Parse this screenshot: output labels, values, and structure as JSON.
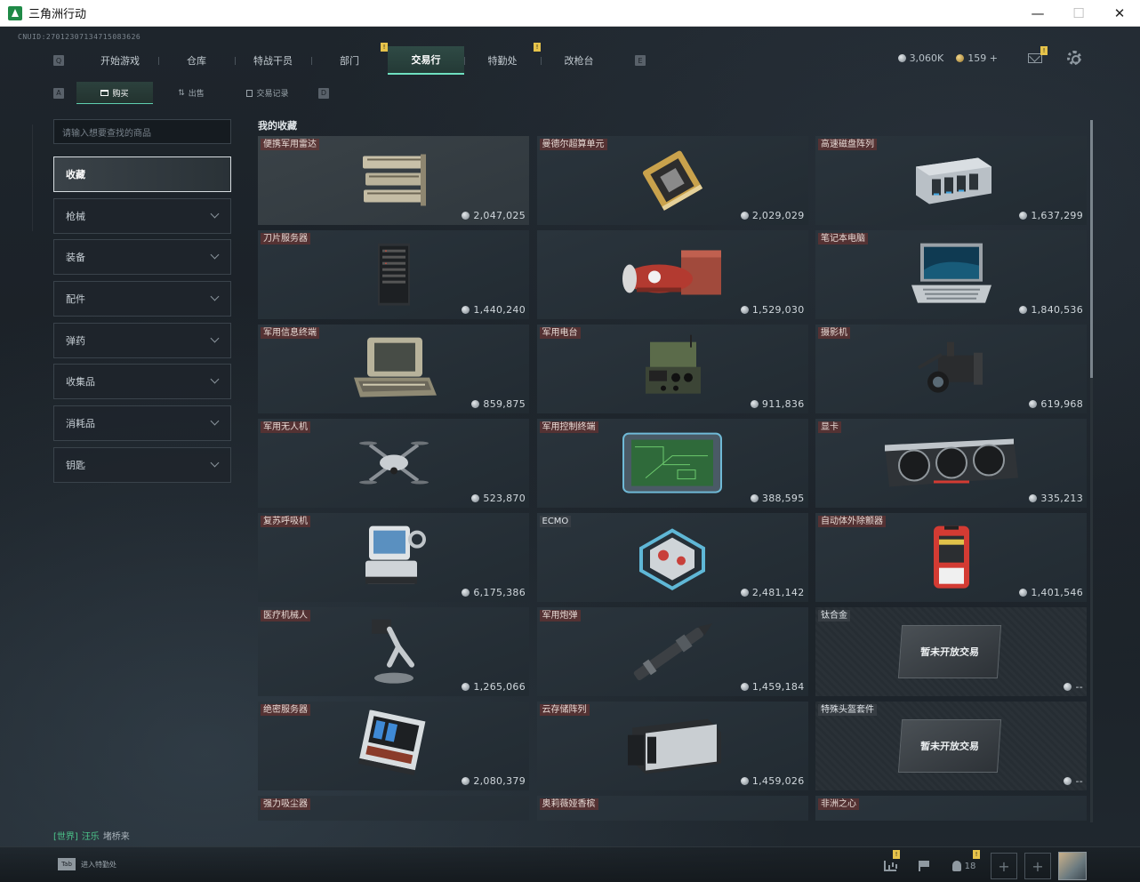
{
  "window": {
    "title": "三角洲行动",
    "controls": {
      "minimize": "—",
      "maximize": "☐",
      "close": "✕"
    }
  },
  "uid": "CNUID:270123071347150836​26",
  "nav": {
    "left_key": "Q",
    "right_key": "E",
    "tabs": [
      {
        "label": "开始游戏"
      },
      {
        "label": "仓库"
      },
      {
        "label": "特战干员"
      },
      {
        "label": "部门",
        "badge": "!"
      },
      {
        "label": "交易行",
        "active": true
      },
      {
        "label": "特勤处",
        "badge": "!"
      },
      {
        "label": "改枪台"
      }
    ]
  },
  "currency": {
    "silver": "3,060K",
    "gold": "159",
    "gold_add": "+"
  },
  "subnav": {
    "left_key": "A",
    "right_key": "D",
    "tabs": [
      {
        "label": "购买",
        "active": true
      },
      {
        "label": "出售"
      },
      {
        "label": "交易记录"
      }
    ]
  },
  "search": {
    "placeholder": "请输入想要查找的商品"
  },
  "sidebar": {
    "items": [
      {
        "label": "收藏",
        "active": true
      },
      {
        "label": "枪械"
      },
      {
        "label": "装备"
      },
      {
        "label": "配件"
      },
      {
        "label": "弹药"
      },
      {
        "label": "收集品"
      },
      {
        "label": "消耗品"
      },
      {
        "label": "钥匙"
      }
    ]
  },
  "section_title": "我的收藏",
  "items": [
    {
      "name": "便携军用雷达",
      "price": "2,047,025",
      "art": "radar",
      "highlight": true
    },
    {
      "name": "曼德尔超算单元",
      "price": "2,029,029",
      "art": "supercomputer"
    },
    {
      "name": "高速磁盘阵列",
      "price": "1,637,299",
      "art": "disk-array"
    },
    {
      "name": "刀片服务器",
      "price": "1,440,240",
      "art": "blade-server"
    },
    {
      "name": "",
      "price": "1,529,030",
      "art": "fuel-cell"
    },
    {
      "name": "笔记本电脑",
      "price": "1,840,536",
      "art": "laptop"
    },
    {
      "name": "军用信息终端",
      "price": "859,875",
      "art": "rugged-terminal"
    },
    {
      "name": "军用电台",
      "price": "911,836",
      "art": "radio"
    },
    {
      "name": "摄影机",
      "price": "619,968",
      "art": "camera"
    },
    {
      "name": "军用无人机",
      "price": "523,870",
      "art": "drone"
    },
    {
      "name": "军用控制终端",
      "price": "388,595",
      "art": "control-terminal"
    },
    {
      "name": "显卡",
      "price": "335,213",
      "art": "gpu"
    },
    {
      "name": "复苏呼吸机",
      "price": "6,175,386",
      "art": "ventilator"
    },
    {
      "name": "ECMO",
      "price": "2,481,142",
      "art": "ecmo",
      "plain_label": true
    },
    {
      "name": "自动体外除颤器",
      "price": "1,401,546",
      "art": "defibrillator"
    },
    {
      "name": "医疗机械人",
      "price": "1,265,066",
      "art": "medical-robot"
    },
    {
      "name": "军用炮弹",
      "price": "1,459,184",
      "art": "shell"
    },
    {
      "name": "钛合金",
      "price": "--",
      "locked": true,
      "locked_text": "暂未开放交易"
    },
    {
      "name": "绝密服务器",
      "price": "2,080,379",
      "art": "secret-server"
    },
    {
      "name": "云存储阵列",
      "price": "1,459,026",
      "art": "cloud-array"
    },
    {
      "name": "特殊头盔套件",
      "price": "--",
      "locked": true,
      "locked_text": "暂未开放交易"
    },
    {
      "name": "强力吸尘器",
      "price": "",
      "art": "vacuum"
    },
    {
      "name": "奥莉薇娅香槟",
      "price": "",
      "art": "bottle"
    },
    {
      "name": "非洲之心",
      "price": "",
      "art": "gem"
    }
  ],
  "chat": {
    "channel": "[世界]",
    "user": "汪乐",
    "message": "堵桥来"
  },
  "bottom": {
    "tab_key": "Tab",
    "tab_label": "进入特勤处",
    "friends_count": "18",
    "plus": "+"
  },
  "colors": {
    "accent": "#6fe0c0",
    "badge": "#e6c34a",
    "chat": "#4cc48a"
  }
}
